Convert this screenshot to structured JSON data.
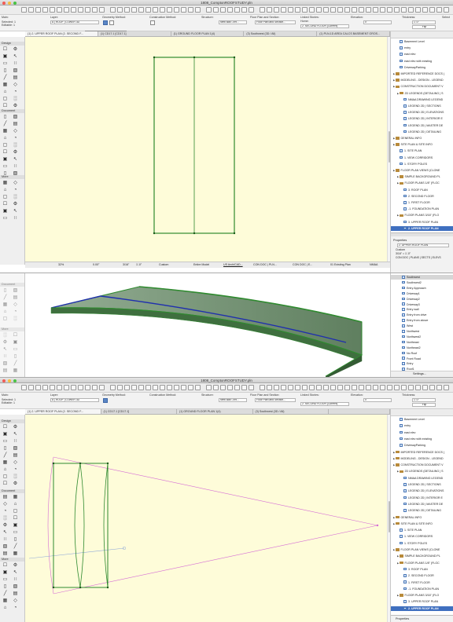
{
  "window_top": {
    "title": "1808_ComptonROOFSTUDY.pln",
    "infobox": {
      "labels": [
        "Main:",
        "Layer:",
        "Geometry Method:",
        "Construction Method:",
        "Structure:",
        "Floor Plan and Section:",
        "Linked Stories:",
        "Elevation:",
        "Thickness:"
      ],
      "selected": "Selected: 1 Editable: 1",
      "layer_value": "A | ROOF | LOWER 3D",
      "structure_value": "New wall: 299...",
      "floor_plan_value": "Floor Plan and Section...",
      "linked_home": "Home:",
      "linked_value": "2. SECOND FLOOR (Current)",
      "elevation_value": "0'",
      "thickness_value": "1'-0\"",
      "flip_label": "Flip",
      "select_label": "Select"
    },
    "tooltip": "Geometry Method: Extruded",
    "tabs": [
      "(1) 2. UPPER ROOF PLAN (2. SECOND F...",
      "(1) CD17.1 [CD17.1]",
      "(1) GROUND FLOOR PLAN 1(4)",
      "(3) Southwest (3D / All)",
      "(1) PLN-1D AREA CALCS BASEMENT GROS..."
    ],
    "status_bar": [
      "32%",
      "0.00°",
      "3/16\"",
      "1'-0\"",
      "Custom",
      "Entire Model",
      "US ArchiCAD...",
      "CON DOC | PLN...",
      "CON DOC | E...",
      "01 Existing Plan",
      "NMAA"
    ]
  },
  "toolbox": {
    "sections": [
      "Design",
      "Document",
      "More"
    ]
  },
  "navigator_top": {
    "items": [
      {
        "label": "Basement Level",
        "kind": "view",
        "indent": 1
      },
      {
        "label": "entry",
        "kind": "view",
        "indent": 1
      },
      {
        "label": "east elev",
        "kind": "view",
        "indent": 1
      },
      {
        "label": "east elev with existing",
        "kind": "view",
        "indent": 1
      },
      {
        "label": "DrivewayParking",
        "kind": "view",
        "indent": 1
      },
      {
        "label": "IMPORTED REFERENCE DOCS (",
        "kind": "folder",
        "indent": 0
      },
      {
        "label": "MODELING - DESIGN - LEGEND",
        "kind": "folder",
        "indent": 0
      },
      {
        "label": "CONSTRUCTION DOCUMENT V",
        "kind": "folder",
        "indent": 0
      },
      {
        "label": "2D LEGENDS (DETAILING | S",
        "kind": "folder",
        "indent": 1
      },
      {
        "label": "NMAA DRAWING LEGEND",
        "kind": "view",
        "indent": 2
      },
      {
        "label": "LEGEND 2D | SECTIONS",
        "kind": "view",
        "indent": 2
      },
      {
        "label": "LEGEND 2D | ELEVATIONS",
        "kind": "view",
        "indent": 2
      },
      {
        "label": "LEGEND 2D | INTERIOR E",
        "kind": "view",
        "indent": 2
      },
      {
        "label": "LEGEND 2D | MASTER DE",
        "kind": "view",
        "indent": 2
      },
      {
        "label": "LEGEND 2D | DETAILING",
        "kind": "view",
        "indent": 2
      },
      {
        "label": "GENERAL INFO",
        "kind": "folder",
        "indent": 0
      },
      {
        "label": "SITE PLAN & SITE INFO",
        "kind": "folder",
        "indent": 0
      },
      {
        "label": "1. SITE PLAN",
        "kind": "view",
        "indent": 1
      },
      {
        "label": "1. VIEW CORRIDORS",
        "kind": "view",
        "indent": 1
      },
      {
        "label": "1. STORY POLES",
        "kind": "view",
        "indent": 1
      },
      {
        "label": "FLOOR PLAN VIEWS (CLONE",
        "kind": "folder",
        "indent": 0
      },
      {
        "label": "SIMPLE BACKGROUND PL",
        "kind": "folder",
        "indent": 1
      },
      {
        "label": "FLOOR PLANS 1/8\" (FLOC",
        "kind": "folder",
        "indent": 1
      },
      {
        "label": "3. ROOF PLAN",
        "kind": "view",
        "indent": 2
      },
      {
        "label": "2. SECOND FLOOR",
        "kind": "view",
        "indent": 2
      },
      {
        "label": "1. FIRST FLOOR",
        "kind": "view",
        "indent": 2
      },
      {
        "label": "-1. FOUNDATION PLAN",
        "kind": "view",
        "indent": 2
      },
      {
        "label": "FLOOR PLANS 3/16\" (FLO",
        "kind": "folder",
        "indent": 1
      },
      {
        "label": "3. UPPER ROOF PLAN",
        "kind": "view",
        "indent": 2
      },
      {
        "label": "2. UPPER ROOF PLAN",
        "kind": "view",
        "indent": 2,
        "selected": true
      }
    ],
    "properties_title": "Properties",
    "properties_value": "2. UPPER ROOF PLAN",
    "properties_custom": "Custom",
    "properties_scale": "3/16\" =   1'-0\"",
    "properties_layer": "CON DOC | PLANS | SECTS | ELEVS"
  },
  "window_middle": {
    "list_items": [
      "Southwest",
      "Southwest2",
      "Entry Approach",
      "Driveway1",
      "Driveway2",
      "Driveway3",
      "Entry wall",
      "Entry from drive",
      "Entry from above",
      "West",
      "Northwest",
      "Northwest2",
      "Northeast",
      "Northeast2",
      "No Roof",
      "Front Road",
      "Entry",
      "Roof1"
    ],
    "settings_label": "Settings..."
  },
  "window_bottom": {
    "title": "1808_ComptonROOFSTUDY.pln",
    "tabs": [
      "(1) 2. UPPER ROOF PLAN (2. SECOND F...",
      "(1) CD17.1 [CD17.1]",
      "(1) GROUND FLOOR PLAN 1(4)",
      "(3) Southwest (3D / All)"
    ],
    "layer_value": "A | ROOF | LOWER 3D",
    "linked_value": "2. SECOND FLOOR (Current)",
    "navigator_items": [
      {
        "label": "Basement Level",
        "kind": "view",
        "indent": 1
      },
      {
        "label": "entry",
        "kind": "view",
        "indent": 1
      },
      {
        "label": "east elev",
        "kind": "view",
        "indent": 1
      },
      {
        "label": "east elev with existing",
        "kind": "view",
        "indent": 1
      },
      {
        "label": "DrivewayParking",
        "kind": "view",
        "indent": 1
      },
      {
        "label": "IMPORTED REFERENCE DOCS (",
        "kind": "folder",
        "indent": 0
      },
      {
        "label": "MODELING - DESIGN - LEGEND",
        "kind": "folder",
        "indent": 0
      },
      {
        "label": "CONSTRUCTION DOCUMENT V",
        "kind": "folder",
        "indent": 0
      },
      {
        "label": "2D LEGENDS (DETAILING | S",
        "kind": "folder",
        "indent": 1
      },
      {
        "label": "NMAA DRAWING LEGEND",
        "kind": "view",
        "indent": 2
      },
      {
        "label": "LEGEND 2D | SECTIONS",
        "kind": "view",
        "indent": 2
      },
      {
        "label": "LEGEND 2D | ELEVATIONS",
        "kind": "view",
        "indent": 2
      },
      {
        "label": "LEGEND 2D | INTERIOR E",
        "kind": "view",
        "indent": 2
      },
      {
        "label": "LEGEND 2D | MASTER DE",
        "kind": "view",
        "indent": 2
      },
      {
        "label": "LEGEND 2D | DETAILING",
        "kind": "view",
        "indent": 2
      },
      {
        "label": "GENERAL INFO",
        "kind": "folder",
        "indent": 0
      },
      {
        "label": "SITE PLAN & SITE INFO",
        "kind": "folder",
        "indent": 0
      },
      {
        "label": "1. SITE PLAN",
        "kind": "view",
        "indent": 1
      },
      {
        "label": "1. VIEW CORRIDORS",
        "kind": "view",
        "indent": 1
      },
      {
        "label": "1. STORY POLES",
        "kind": "view",
        "indent": 1
      },
      {
        "label": "FLOOR PLAN VIEWS (CLONE",
        "kind": "folder",
        "indent": 0
      },
      {
        "label": "SIMPLE BACKGROUND PL",
        "kind": "folder",
        "indent": 1
      },
      {
        "label": "FLOOR PLANS 1/8\" (FLOC",
        "kind": "folder",
        "indent": 1
      },
      {
        "label": "3. ROOF PLAN",
        "kind": "view",
        "indent": 2
      },
      {
        "label": "2. SECOND FLOOR",
        "kind": "view",
        "indent": 2
      },
      {
        "label": "1. FIRST FLOOR",
        "kind": "view",
        "indent": 2
      },
      {
        "label": "-1. FOUNDATION PLAN",
        "kind": "view",
        "indent": 2
      },
      {
        "label": "FLOOR PLANS 3/16\" (FLO",
        "kind": "folder",
        "indent": 1
      },
      {
        "label": "3. UPPER ROOF PLAN",
        "kind": "view",
        "indent": 2
      },
      {
        "label": "2. UPPER ROOF PLAN",
        "kind": "view",
        "indent": 2,
        "selected": true
      }
    ],
    "properties_title": "Properties"
  },
  "colors": {
    "canvas_bg": "#fefcd9",
    "roof_edge": "#2f8a2f",
    "roof_fill": "#7f9f7f",
    "ridge_line": "#1f2fae",
    "guide_line": "#d56cd5",
    "selection": "#3f6fbf"
  }
}
